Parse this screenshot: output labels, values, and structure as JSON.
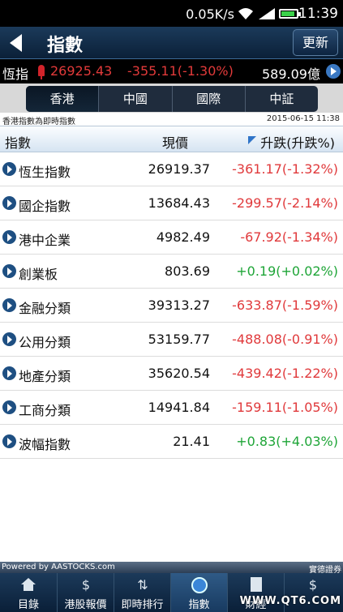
{
  "status_bar": {
    "speed": "0.05K/s",
    "time": "11:39"
  },
  "header": {
    "title": "指數",
    "refresh_label": "更新"
  },
  "ticker": {
    "name": "恆指",
    "price": "26925.43",
    "change": "-355.11(-1.30%)",
    "turnover": "589.09億"
  },
  "tabs": [
    {
      "label": "香港",
      "active": true
    },
    {
      "label": "中國",
      "active": false
    },
    {
      "label": "國際",
      "active": false
    },
    {
      "label": "中証",
      "active": false
    }
  ],
  "info": {
    "note": "香港指數為即時指數",
    "datetime": "2015-06-15 11:38"
  },
  "table": {
    "headers": [
      "指數",
      "現價",
      "升跌(升跌%)"
    ],
    "rows": [
      {
        "name": "恆生指數",
        "price": "26919.37",
        "change": "-361.17(-1.32%)",
        "direction": "down"
      },
      {
        "name": "國企指數",
        "price": "13684.43",
        "change": "-299.57(-2.14%)",
        "direction": "down"
      },
      {
        "name": "港中企業",
        "price": "4982.49",
        "change": "-67.92(-1.34%)",
        "direction": "down"
      },
      {
        "name": "創業板",
        "price": "803.69",
        "change": "+0.19(+0.02%)",
        "direction": "up"
      },
      {
        "name": "金融分類",
        "price": "39313.27",
        "change": "-633.87(-1.59%)",
        "direction": "down"
      },
      {
        "name": "公用分類",
        "price": "53159.77",
        "change": "-488.08(-0.91%)",
        "direction": "down"
      },
      {
        "name": "地產分類",
        "price": "35620.54",
        "change": "-439.42(-1.22%)",
        "direction": "down"
      },
      {
        "name": "工商分類",
        "price": "14941.84",
        "change": "-159.11(-1.05%)",
        "direction": "down"
      },
      {
        "name": "波幅指數",
        "price": "21.41",
        "change": "+0.83(+4.03%)",
        "direction": "up"
      }
    ]
  },
  "footer": {
    "powered_by": "Powered by AASTOCKS.com",
    "brand": "實德證券"
  },
  "bottom_nav": [
    {
      "label": "目錄",
      "icon": "home-icon",
      "active": false
    },
    {
      "label": "港股報價",
      "icon": "dollar-icon",
      "active": false
    },
    {
      "label": "即時排行",
      "icon": "updown-arrows-icon",
      "active": false
    },
    {
      "label": "指數",
      "icon": "globe-icon",
      "active": true
    },
    {
      "label": "財經",
      "icon": "document-icon",
      "active": false
    },
    {
      "label": "",
      "icon": "dollar-icon",
      "active": false
    }
  ],
  "watermark": "WWW.QT6.COM",
  "colors": {
    "down": "#e0393b",
    "up": "#1ea537",
    "header_bg": "#0b2038",
    "accent": "#2f74c8"
  }
}
